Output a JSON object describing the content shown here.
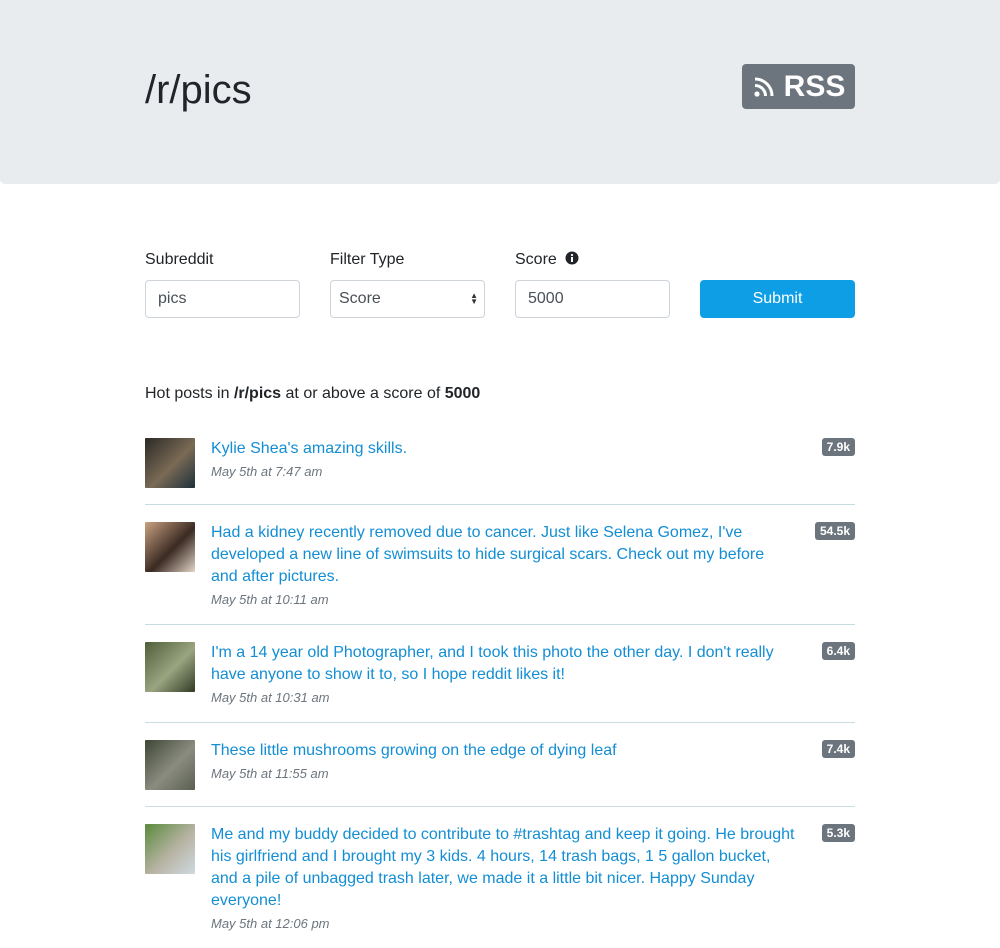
{
  "header": {
    "title": "/r/pics",
    "rss_label": "RSS"
  },
  "form": {
    "subreddit_label": "Subreddit",
    "subreddit_value": "pics",
    "filter_label": "Filter Type",
    "filter_value": "Score",
    "score_label": "Score",
    "score_value": "5000",
    "submit_label": "Submit"
  },
  "summary": {
    "prefix": "Hot posts in ",
    "subreddit": "/r/pics",
    "middle": " at or above a score of ",
    "score": "5000"
  },
  "posts": [
    {
      "title": "Kylie Shea's amazing skills.",
      "date": "May 5th at 7:47 am",
      "score": "7.9k",
      "thumb_colors": [
        "#2b2a26",
        "#7a6a55",
        "#1d2f3a"
      ]
    },
    {
      "title": "Had a kidney recently removed due to cancer. Just like Selena Gomez, I've developed a new line of swimsuits to hide surgical scars. Check out my before and after pictures.",
      "date": "May 5th at 10:11 am",
      "score": "54.5k",
      "thumb_colors": [
        "#caa283",
        "#3a2a22",
        "#e3d6c8"
      ]
    },
    {
      "title": "I'm a 14 year old Photographer, and I took this photo the other day. I don't really have anyone to show it to, so I hope reddit likes it!",
      "date": "May 5th at 10:31 am",
      "score": "6.4k",
      "thumb_colors": [
        "#4f5e3a",
        "#9aa480",
        "#2f3a24"
      ]
    },
    {
      "title": "These little mushrooms growing on the edge of dying leaf",
      "date": "May 5th at 11:55 am",
      "score": "7.4k",
      "thumb_colors": [
        "#3f4636",
        "#8a8c7f",
        "#5a5f52"
      ]
    },
    {
      "title": "Me and my buddy decided to contribute to #trashtag and keep it going. He brought his girlfriend and I brought my 3 kids. 4 hours, 14 trash bags, 1 5 gallon bucket, and a pile of unbagged trash later, we made it a little bit nicer. Happy Sunday everyone!",
      "date": "May 5th at 12:06 pm",
      "score": "5.3k",
      "thumb_colors": [
        "#5a8a3c",
        "#b7b3a3",
        "#cfd9e0"
      ]
    }
  ],
  "colors": {
    "accent": "#0e9ee6",
    "link": "#138ed4",
    "badge": "#6c757d",
    "hero_bg": "#e9ecef"
  }
}
